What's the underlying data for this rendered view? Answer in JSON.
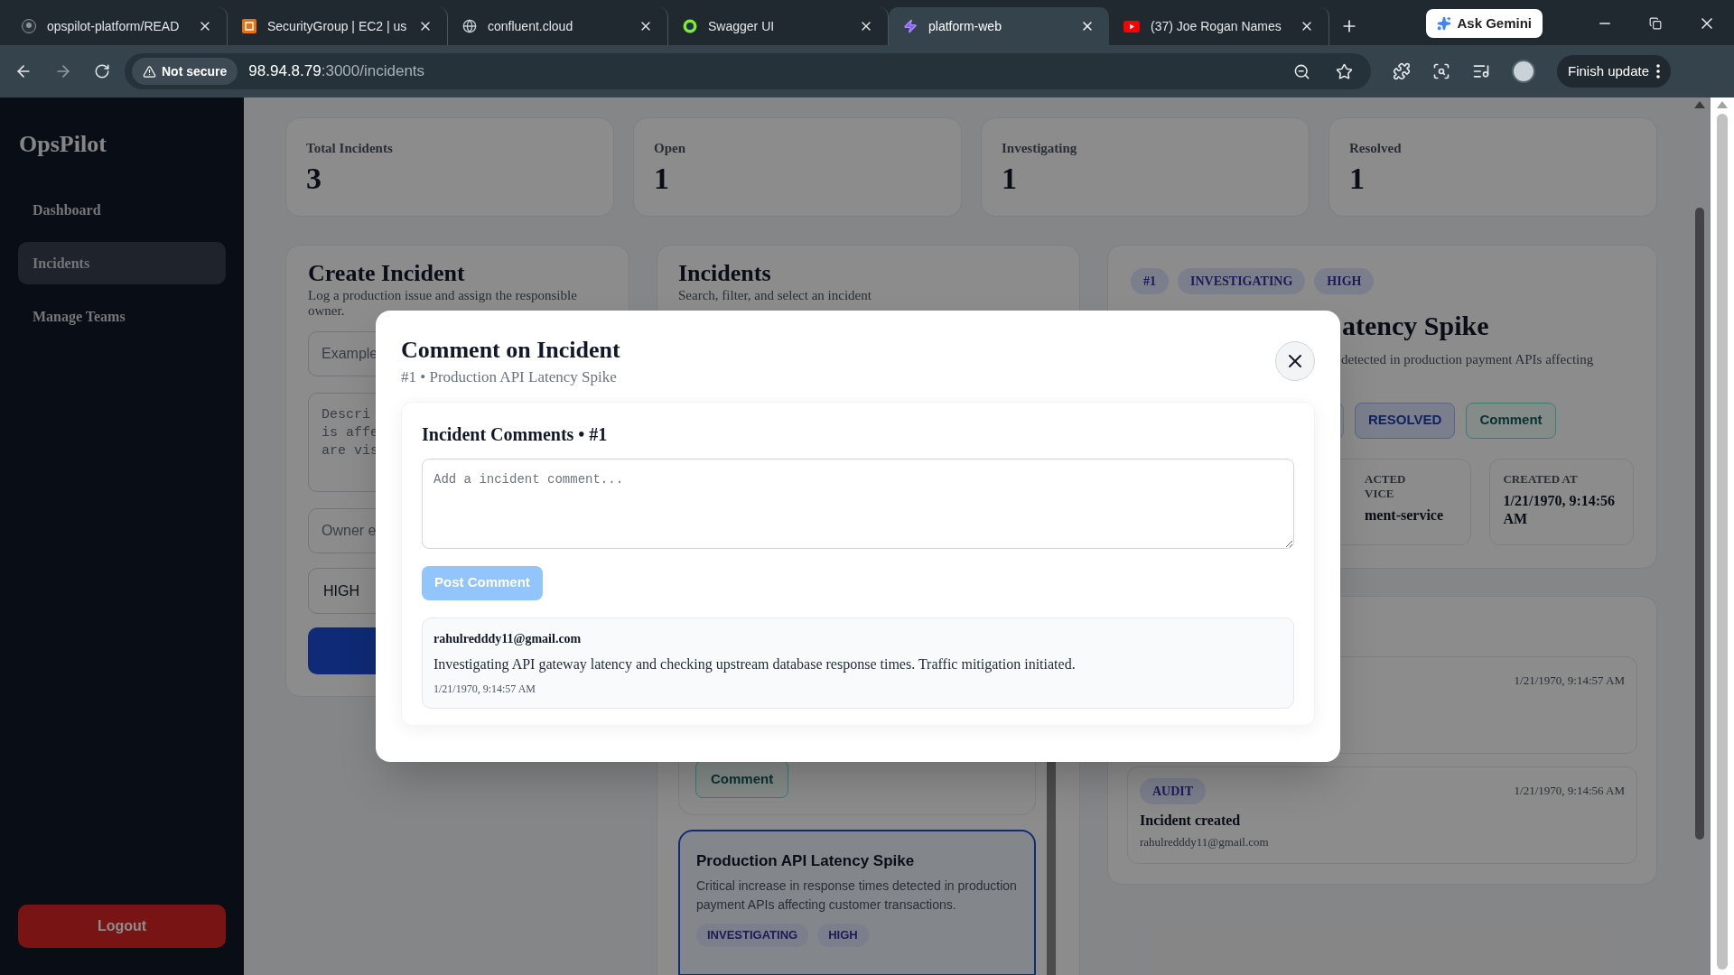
{
  "browser": {
    "tabs": [
      {
        "title": "opspilot-platform/READ",
        "kind": "github",
        "selected": false
      },
      {
        "title": "SecurityGroup | EC2 | us",
        "kind": "aws",
        "selected": false
      },
      {
        "title": "confluent.cloud",
        "kind": "globe",
        "selected": false
      },
      {
        "title": "Swagger UI",
        "kind": "swagger",
        "selected": false
      },
      {
        "title": "platform-web",
        "kind": "bolt",
        "selected": true
      },
      {
        "title": "(37) Joe Rogan Names",
        "kind": "video",
        "selected": false
      }
    ],
    "ask_button": "Ask Gemini",
    "security": "Not secure",
    "url_host": "98.94.8.79",
    "url_path": ":3000/incidents",
    "update_button": "Finish update"
  },
  "sidebar": {
    "brand": "OpsPilot",
    "items": [
      {
        "label": "Dashboard",
        "selected": false
      },
      {
        "label": "Incidents",
        "selected": true
      },
      {
        "label": "Manage Teams",
        "selected": false
      }
    ],
    "logout": "Logout"
  },
  "stats": [
    {
      "label": "Total Incidents",
      "value": "3"
    },
    {
      "label": "Open",
      "value": "1"
    },
    {
      "label": "Investigating",
      "value": "1"
    },
    {
      "label": "Resolved",
      "value": "1"
    }
  ],
  "create_panel": {
    "title": "Create Incident",
    "description": "Log a production issue and assign the responsible owner.",
    "title_placeholder": "Example",
    "description_placeholder_lines": [
      "Descri",
      "is affe",
      "are vis"
    ],
    "owner_placeholder": "Owner e",
    "severity": "HIGH"
  },
  "incidents_panel": {
    "title": "Incidents",
    "description": "Search, filter, and select an incident",
    "cards": [
      {
        "kind": "partial",
        "selected": false,
        "button": "Comment"
      },
      {
        "kind": "full",
        "selected": true,
        "title": "Production API Latency Spike",
        "description": "Critical increase in response times detected in production payment APIs affecting customer transactions.",
        "chips": [
          "INVESTIGATING",
          "HIGH"
        ]
      }
    ]
  },
  "detail_panel": {
    "chips": [
      "#1",
      "INVESTIGATING",
      "HIGH"
    ],
    "title": "atency Spike",
    "description": "detected in production payment APIs affecting",
    "actions": [
      {
        "label": "RESOLVED",
        "kind": "status"
      },
      {
        "label": "Comment",
        "kind": "comment"
      }
    ],
    "fields": [
      {
        "label_lines": [
          "ACTED",
          "VICE"
        ],
        "value": "ment-service"
      },
      {
        "label_lines": [
          "CREATED AT"
        ],
        "value": "1/21/1970, 9:14:56 AM"
      }
    ]
  },
  "timeline": {
    "items": [
      {
        "time": "1/21/1970, 9:14:57 AM"
      },
      {
        "tag": "AUDIT",
        "time": "1/21/1970, 9:14:56 AM",
        "title": "Incident created",
        "author": "rahulredddy11@gmail.com"
      }
    ]
  },
  "modal": {
    "title": "Comment on Incident",
    "subtitle": "#1 • Production API Latency Spike",
    "section_title": "Incident Comments • #1",
    "placeholder": "Add a incident comment...",
    "post_button": {
      "label": "Post Comment",
      "disabled": true
    },
    "comments": [
      {
        "author": "rahulredddy11@gmail.com",
        "text": "Investigating API gateway latency and checking upstream database response times. Traffic mitigation initiated.",
        "time": "1/21/1970, 9:14:57 AM"
      }
    ]
  }
}
